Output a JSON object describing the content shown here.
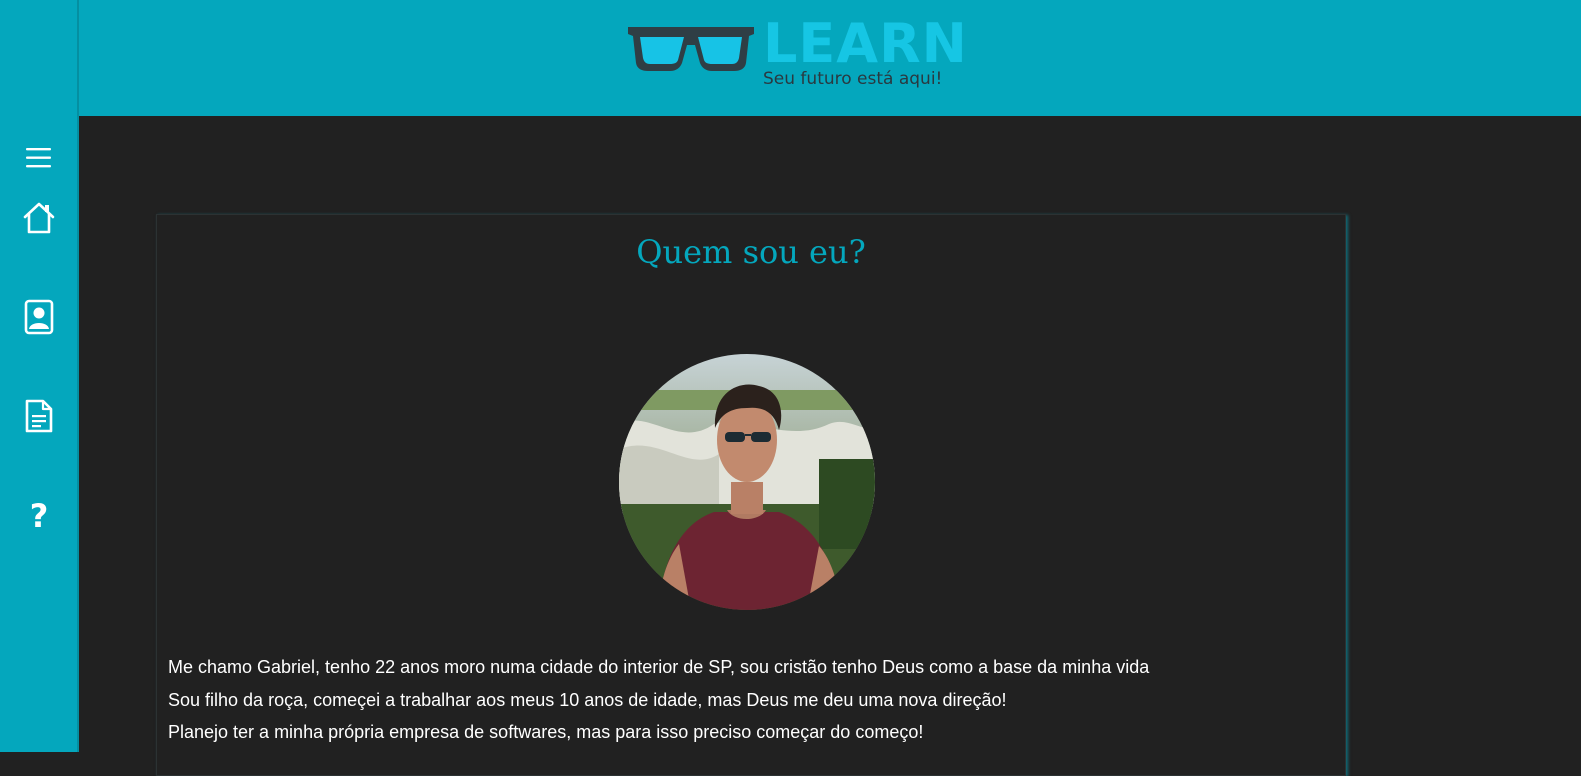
{
  "header": {
    "logo_word": "LEARN",
    "logo_tagline": "Seu futuro está aqui!",
    "logo_icon": "glasses-icon"
  },
  "sidebar": {
    "items": [
      {
        "icon": "menu-icon"
      },
      {
        "icon": "home-icon"
      },
      {
        "icon": "profile-card-icon"
      },
      {
        "icon": "document-icon"
      },
      {
        "icon": "help-icon",
        "glyph": "?"
      }
    ]
  },
  "main": {
    "title": "Quem sou eu?",
    "bio": [
      "Me chamo Gabriel, tenho 22 anos moro numa cidade do interior de SP, sou cristão tenho Deus como a base da minha vida",
      "Sou filho da roça, começei a trabalhar aos meus 10 anos de idade, mas Deus me deu uma nova direção!",
      "Planejo ter a minha própria empresa de softwares, mas para isso preciso começar do começo!"
    ]
  },
  "colors": {
    "accent": "#04a7bd",
    "logo_accent": "#16c6e4",
    "background": "#212121",
    "text": "#ffffff"
  }
}
